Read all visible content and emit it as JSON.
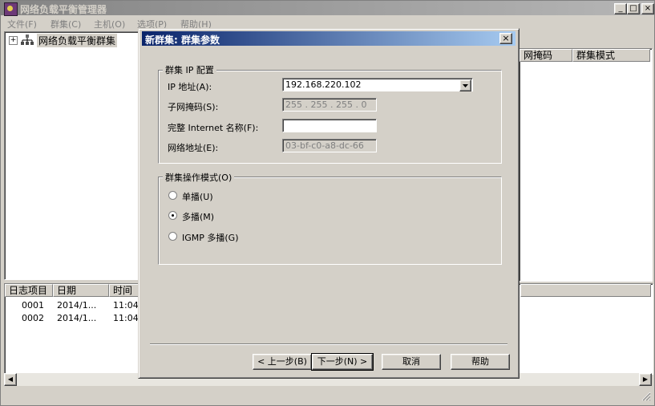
{
  "app": {
    "title": "网络负载平衡管理器",
    "window_buttons": {
      "minimize": "_",
      "maximize": "□",
      "close": "×"
    }
  },
  "menu": [
    "文件(F)",
    "群集(C)",
    "主机(O)",
    "选项(P)",
    "帮助(H)"
  ],
  "tree": {
    "expander": "+",
    "root_label": "网络负载平衡群集"
  },
  "right_list": {
    "columns": [
      "网掩码",
      "群集模式"
    ]
  },
  "log": {
    "columns": [
      "日志项目",
      "日期",
      "时间"
    ],
    "rows": [
      {
        "id": "0001",
        "date": "2014/1...",
        "time": "11:04"
      },
      {
        "id": "0002",
        "date": "2014/1...",
        "time": "11:04"
      }
    ]
  },
  "dialog": {
    "title": "新群集:  群集参数",
    "close": "×",
    "ip_group": {
      "legend": "群集 IP 配置",
      "ip_label": "IP 地址(A):",
      "ip_value": "192.168.220.102",
      "subnet_label": "子网掩码(S):",
      "subnet_value": "255 . 255 . 255 . 0",
      "fullname_label": "完整 Internet 名称(F):",
      "fullname_value": "",
      "netaddr_label": "网络地址(E):",
      "netaddr_value": "03-bf-c0-a8-dc-66"
    },
    "mode_group": {
      "legend": "群集操作模式(O)",
      "options": [
        {
          "label": "单播(U)",
          "selected": false
        },
        {
          "label": "多播(M)",
          "selected": true
        },
        {
          "label": "IGMP 多播(G)",
          "selected": false
        }
      ]
    },
    "buttons": {
      "back": "< 上一步(B)",
      "next": "下一步(N) >",
      "cancel": "取消",
      "help": "帮助"
    }
  },
  "scroll": {
    "left": "◀",
    "right": "▶"
  },
  "colors": {
    "dialog_title_start": "#0a246a",
    "dialog_title_end": "#a6caf0",
    "inactive_title": "#848484"
  }
}
